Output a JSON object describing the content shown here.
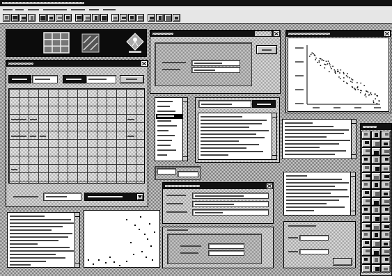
{
  "colors": {
    "desktop_dark": "#6e6e6e",
    "desktop_light": "#d8d8d8",
    "titlebar": "#111111",
    "window_face_dark": "#9a9a9a",
    "window_face_light": "#e6e6e6",
    "content": "#ffffff",
    "border": "#000000"
  },
  "launcher": {
    "icons": [
      "grid-icon",
      "image-icon",
      "logo-icon"
    ]
  },
  "window_controls": {
    "close_icon": "close-icon",
    "dropdown_icon": "chevron-down-icon"
  }
}
